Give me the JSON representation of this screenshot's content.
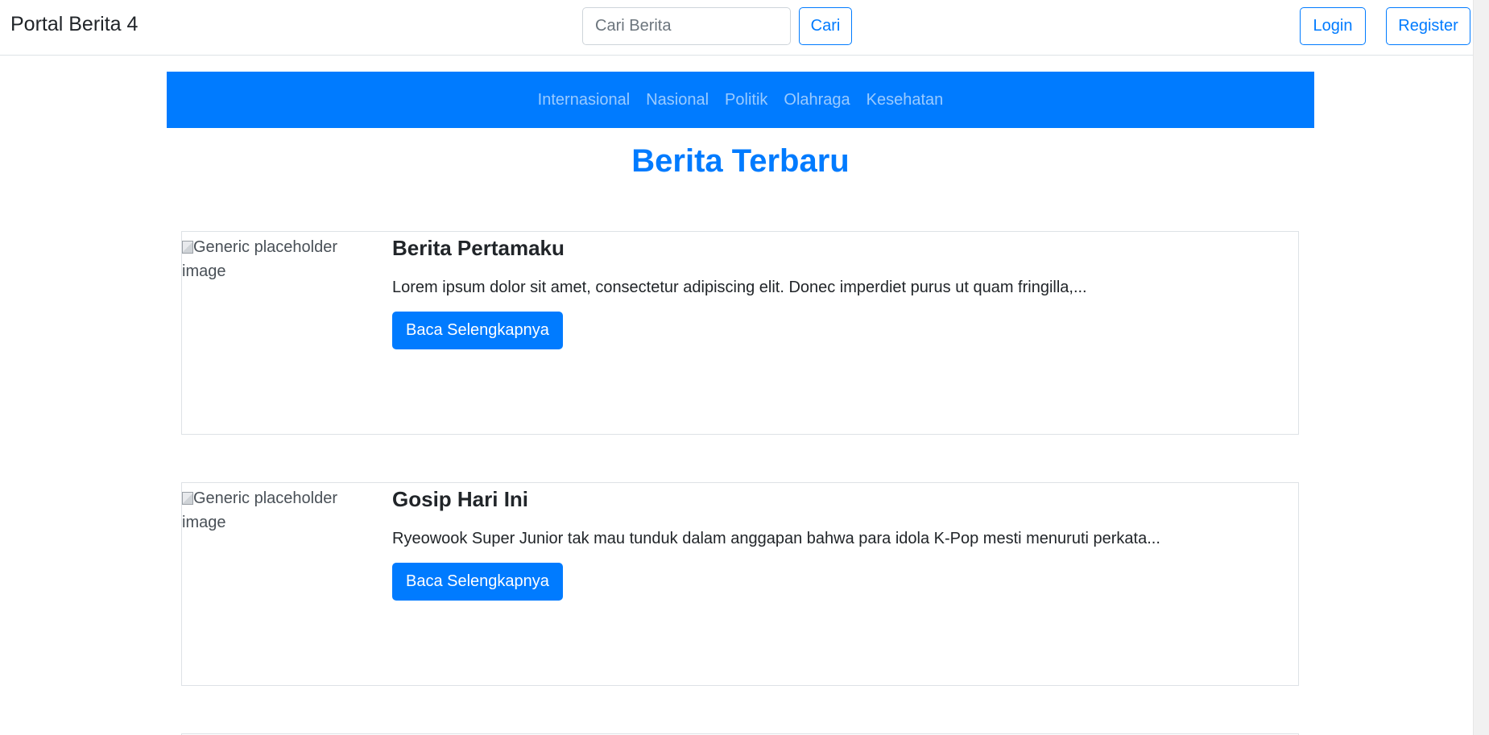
{
  "header": {
    "brand": "Portal Berita 4",
    "search_placeholder": "Cari Berita",
    "search_button": "Cari",
    "login_button": "Login",
    "register_button": "Register"
  },
  "categories": [
    "Internasional",
    "Nasional",
    "Politik",
    "Olahraga",
    "Kesehatan"
  ],
  "main": {
    "title": "Berita Terbaru",
    "articles": [
      {
        "image_alt": "Generic placeholder image",
        "title": "Berita Pertamaku",
        "excerpt": "Lorem ipsum dolor sit amet, consectetur adipiscing elit. Donec imperdiet purus ut quam fringilla,...",
        "button": "Baca Selengkapnya"
      },
      {
        "image_alt": "Generic placeholder image",
        "title": "Gosip Hari Ini",
        "excerpt": "Ryeowook Super Junior tak mau tunduk dalam anggapan bahwa para idola K-Pop mesti menuruti perkata...",
        "button": "Baca Selengkapnya"
      }
    ]
  },
  "colors": {
    "primary": "#007bff",
    "nav_link": "rgba(255,255,255,0.6)",
    "text": "#212529",
    "border": "#dee2e6"
  }
}
